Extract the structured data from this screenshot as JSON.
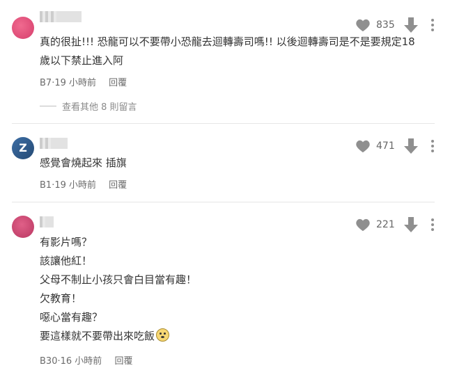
{
  "comments": [
    {
      "content": "真的很扯!!! 恐龍可以不要帶小恐龍去迴轉壽司嗎!! 以後迴轉壽司是不是要規定18\n歲以下禁止進入阿",
      "floor": "B7",
      "time": "19 小時前",
      "reply_label": "回覆",
      "likes": "835",
      "view_more": "查看其他 8 則留言",
      "avatar_color": "#e84d7a"
    },
    {
      "content": "感覺會燒起來 插旗",
      "floor": "B1",
      "time": "19 小時前",
      "reply_label": "回覆",
      "likes": "471",
      "avatar_color": "#2f5c8f"
    },
    {
      "content": "有影片嗎？\n該讓他紅！\n父母不制止小孩只會白目當有趣！\n欠教育！\n噁心當有趣？\n要這樣就不要帶出來吃飯",
      "floor": "B30",
      "time": "16 小時前",
      "reply_label": "回覆",
      "likes": "221",
      "avatar_color": "#c9446b"
    }
  ],
  "icons": {
    "like": "heart-icon",
    "dislike": "arrow-down-icon",
    "more": "more-vertical-icon",
    "emoji": "rolling-eyes-emoji"
  },
  "colors": {
    "icon_gray": "#8f8f8f",
    "text": "#333333",
    "meta": "#6b6b6b"
  }
}
